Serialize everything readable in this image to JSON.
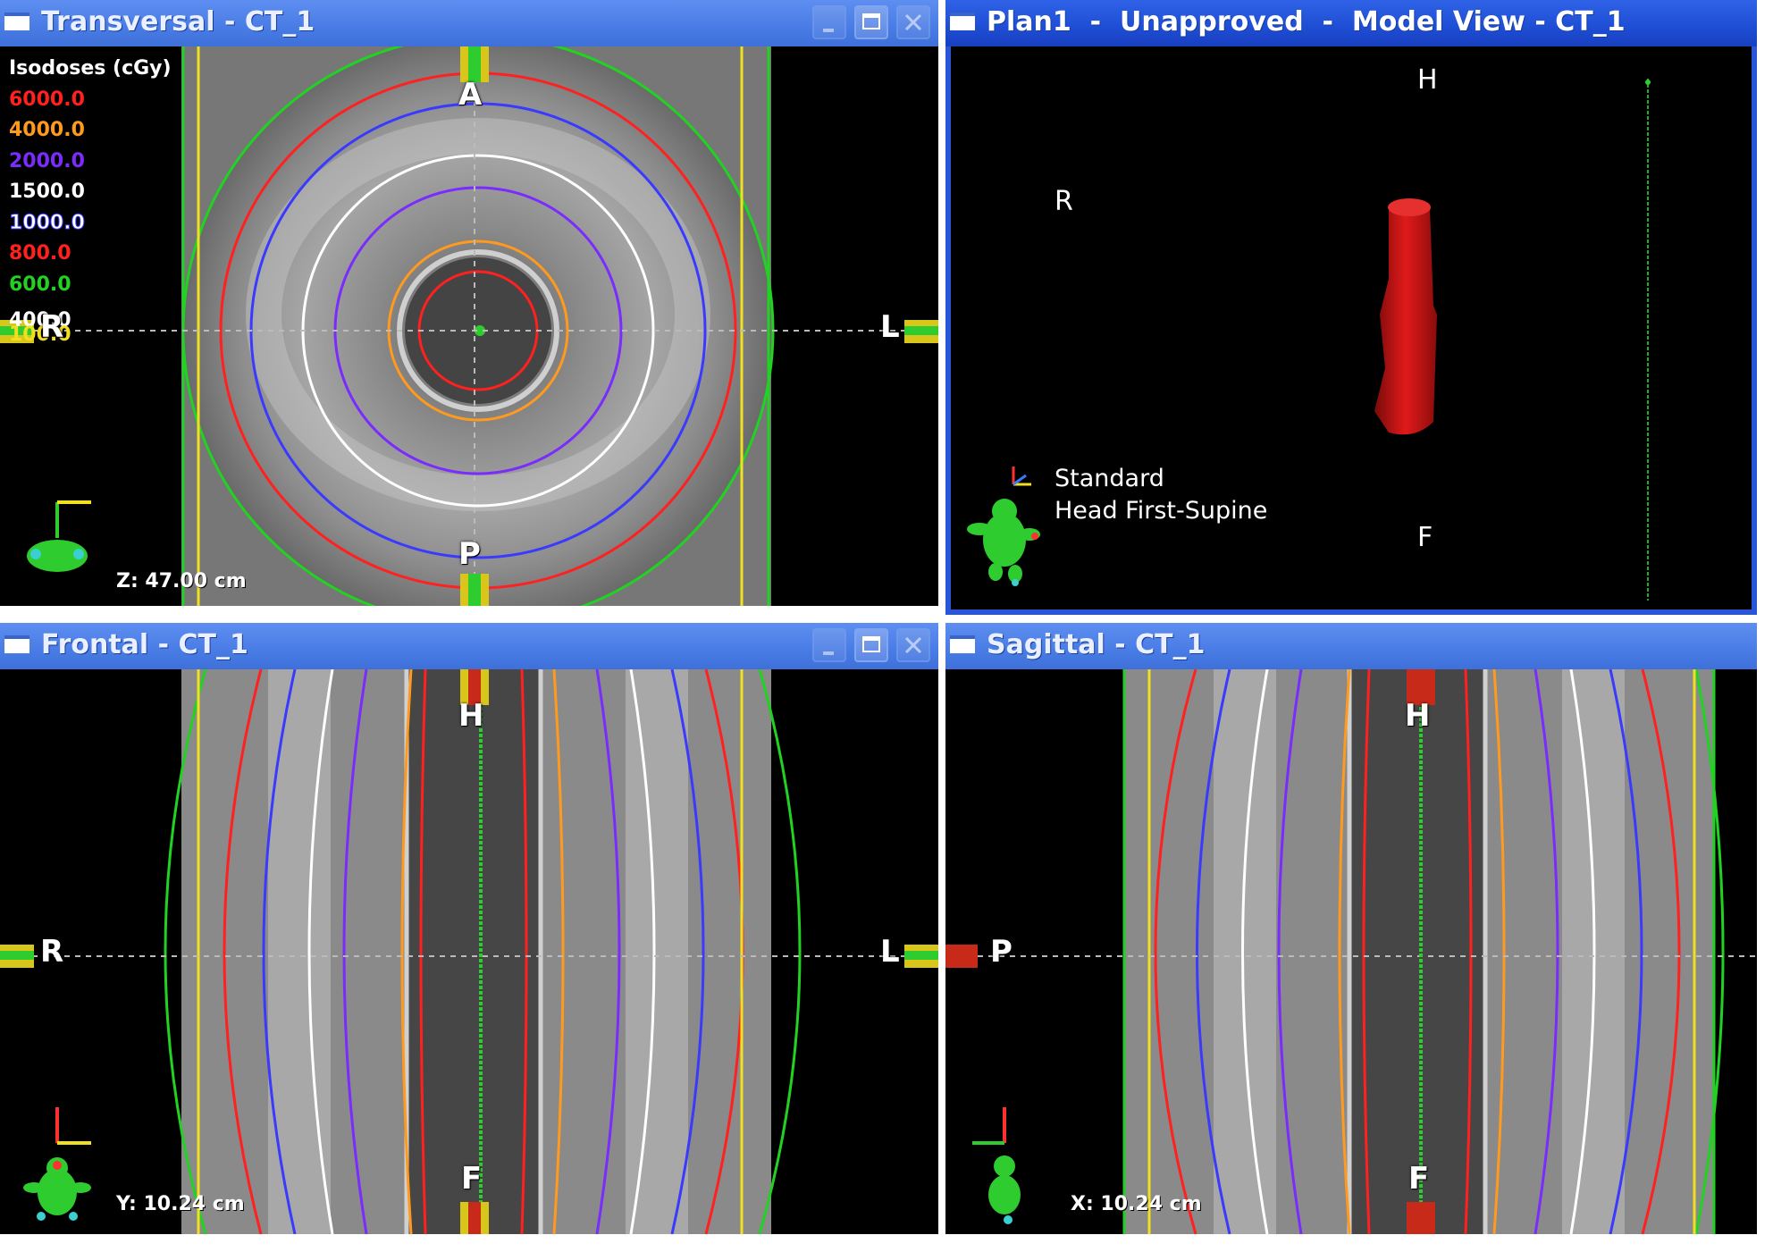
{
  "windows": {
    "transversal": {
      "title": "Transversal - CT_1",
      "orientation": {
        "top": "A",
        "bottom": "P",
        "left": "R",
        "right": "L"
      },
      "coord": "Z: 47.00 cm"
    },
    "model": {
      "title": "Plan1  -  Unapproved  -  Model View - CT_1",
      "orientation": {
        "top": "H",
        "bottom": "F",
        "left": "R"
      },
      "patient_setup": [
        "Standard",
        "Head First-Supine"
      ]
    },
    "frontal": {
      "title": "Frontal - CT_1",
      "orientation": {
        "top": "H",
        "bottom": "F",
        "left": "R",
        "right": "L"
      },
      "coord": "Y: 10.24 cm"
    },
    "sagittal": {
      "title": "Sagittal - CT_1",
      "orientation": {
        "top": "H",
        "bottom": "F",
        "left": "P"
      },
      "coord": "X: 10.24 cm"
    }
  },
  "isodoses": {
    "header": "Isodoses (cGy)",
    "levels": [
      {
        "value": "6000.0",
        "color": "#ff2020"
      },
      {
        "value": "4000.0",
        "color": "#ff9a1e"
      },
      {
        "value": "2000.0",
        "color": "#7a2cff"
      },
      {
        "value": "1500.0",
        "color": "#ffffff"
      },
      {
        "value": "1000.0",
        "color": "#3a3aff"
      },
      {
        "value": "800.0",
        "color": "#ff2020"
      },
      {
        "value": "600.0",
        "color": "#22d222"
      },
      {
        "value": "400.0",
        "color": "#ffffff"
      },
      {
        "value": "100.0",
        "color": "#f0e020"
      }
    ]
  },
  "icons": [
    "window-icon",
    "minimize-icon",
    "maximize-icon",
    "close-icon",
    "patient-orientation-icon",
    "axis-triad-icon"
  ]
}
